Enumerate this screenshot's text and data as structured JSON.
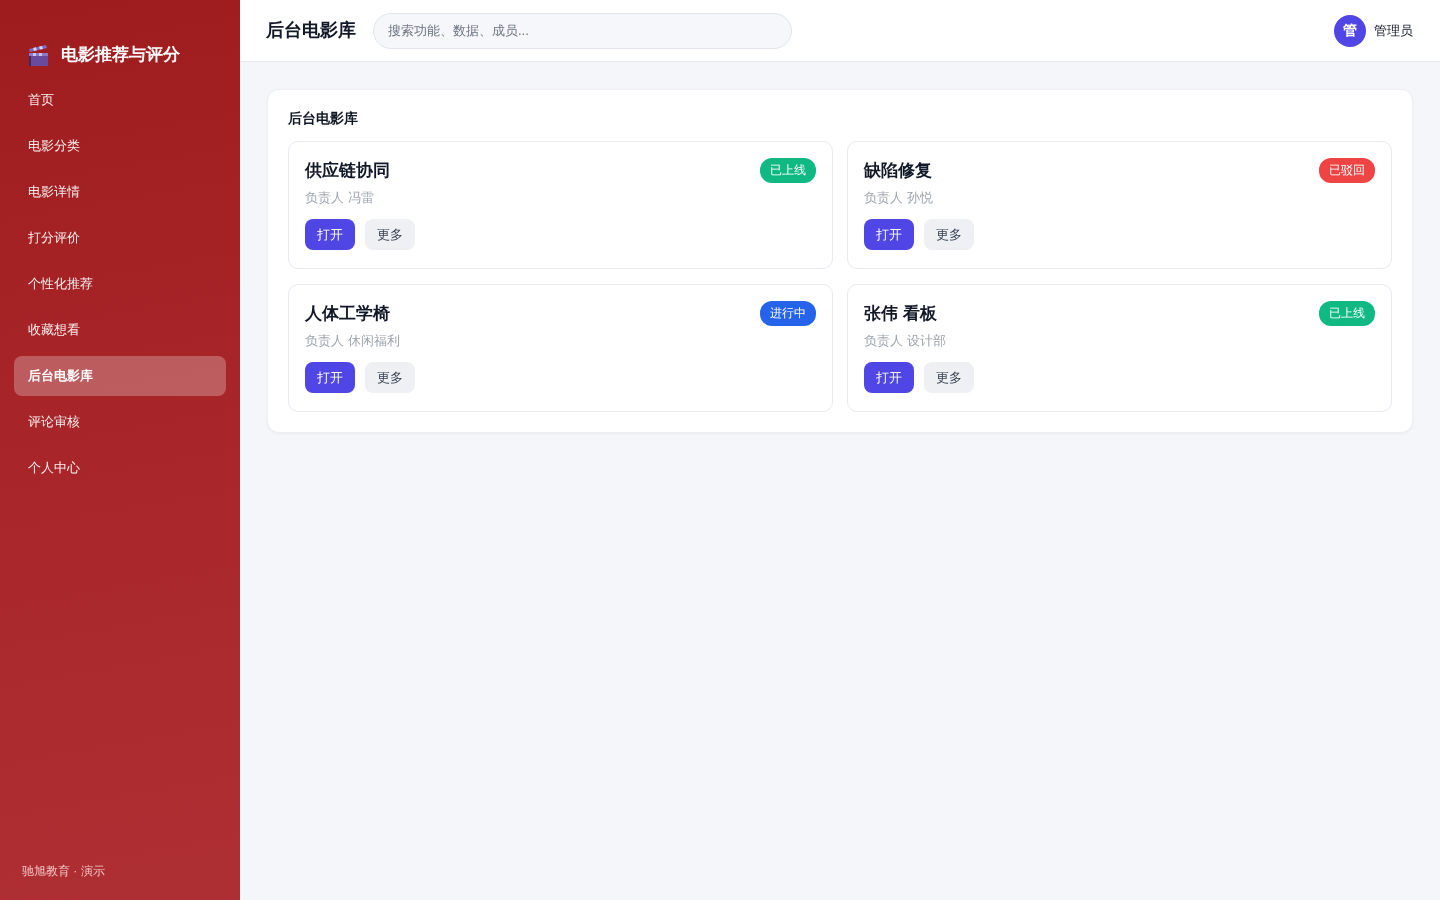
{
  "sidebar": {
    "brand": "电影推荐与评分",
    "items": [
      {
        "label": "首页",
        "selected": false
      },
      {
        "label": "电影分类",
        "selected": false
      },
      {
        "label": "电影详情",
        "selected": false
      },
      {
        "label": "打分评价",
        "selected": false
      },
      {
        "label": "个性化推荐",
        "selected": false
      },
      {
        "label": "收藏想看",
        "selected": false
      },
      {
        "label": "后台电影库",
        "selected": true
      },
      {
        "label": "评论审核",
        "selected": false
      },
      {
        "label": "个人中心",
        "selected": false
      }
    ],
    "footer": "驰旭教育 · 演示"
  },
  "header": {
    "title": "后台电影库",
    "search": {
      "placeholder": "搜索功能、数据、成员..."
    },
    "user": {
      "avatar": "管",
      "name": "管理员"
    }
  },
  "panel": {
    "title": "后台电影库",
    "cards": [
      {
        "title": "供应链协同",
        "owner": "负责人 冯雷",
        "badge": {
          "text": "已上线",
          "color": "#10b981"
        },
        "buttons": [
          {
            "label": "打开",
            "kind": "primary"
          },
          {
            "label": "更多",
            "kind": "secondary"
          }
        ]
      },
      {
        "title": "缺陷修复",
        "owner": "负责人 孙悦",
        "badge": {
          "text": "已驳回",
          "color": "#ef4444"
        },
        "buttons": [
          {
            "label": "打开",
            "kind": "primary"
          },
          {
            "label": "更多",
            "kind": "secondary"
          }
        ]
      },
      {
        "title": "人体工学椅",
        "owner": "负责人 休闲福利",
        "badge": {
          "text": "进行中",
          "color": "#2563eb"
        },
        "buttons": [
          {
            "label": "打开",
            "kind": "primary"
          },
          {
            "label": "更多",
            "kind": "secondary"
          }
        ]
      },
      {
        "title": "张伟 看板",
        "owner": "负责人 设计部",
        "badge": {
          "text": "已上线",
          "color": "#10b981"
        },
        "buttons": [
          {
            "label": "打开",
            "kind": "primary"
          },
          {
            "label": "更多",
            "kind": "secondary"
          }
        ]
      }
    ]
  }
}
